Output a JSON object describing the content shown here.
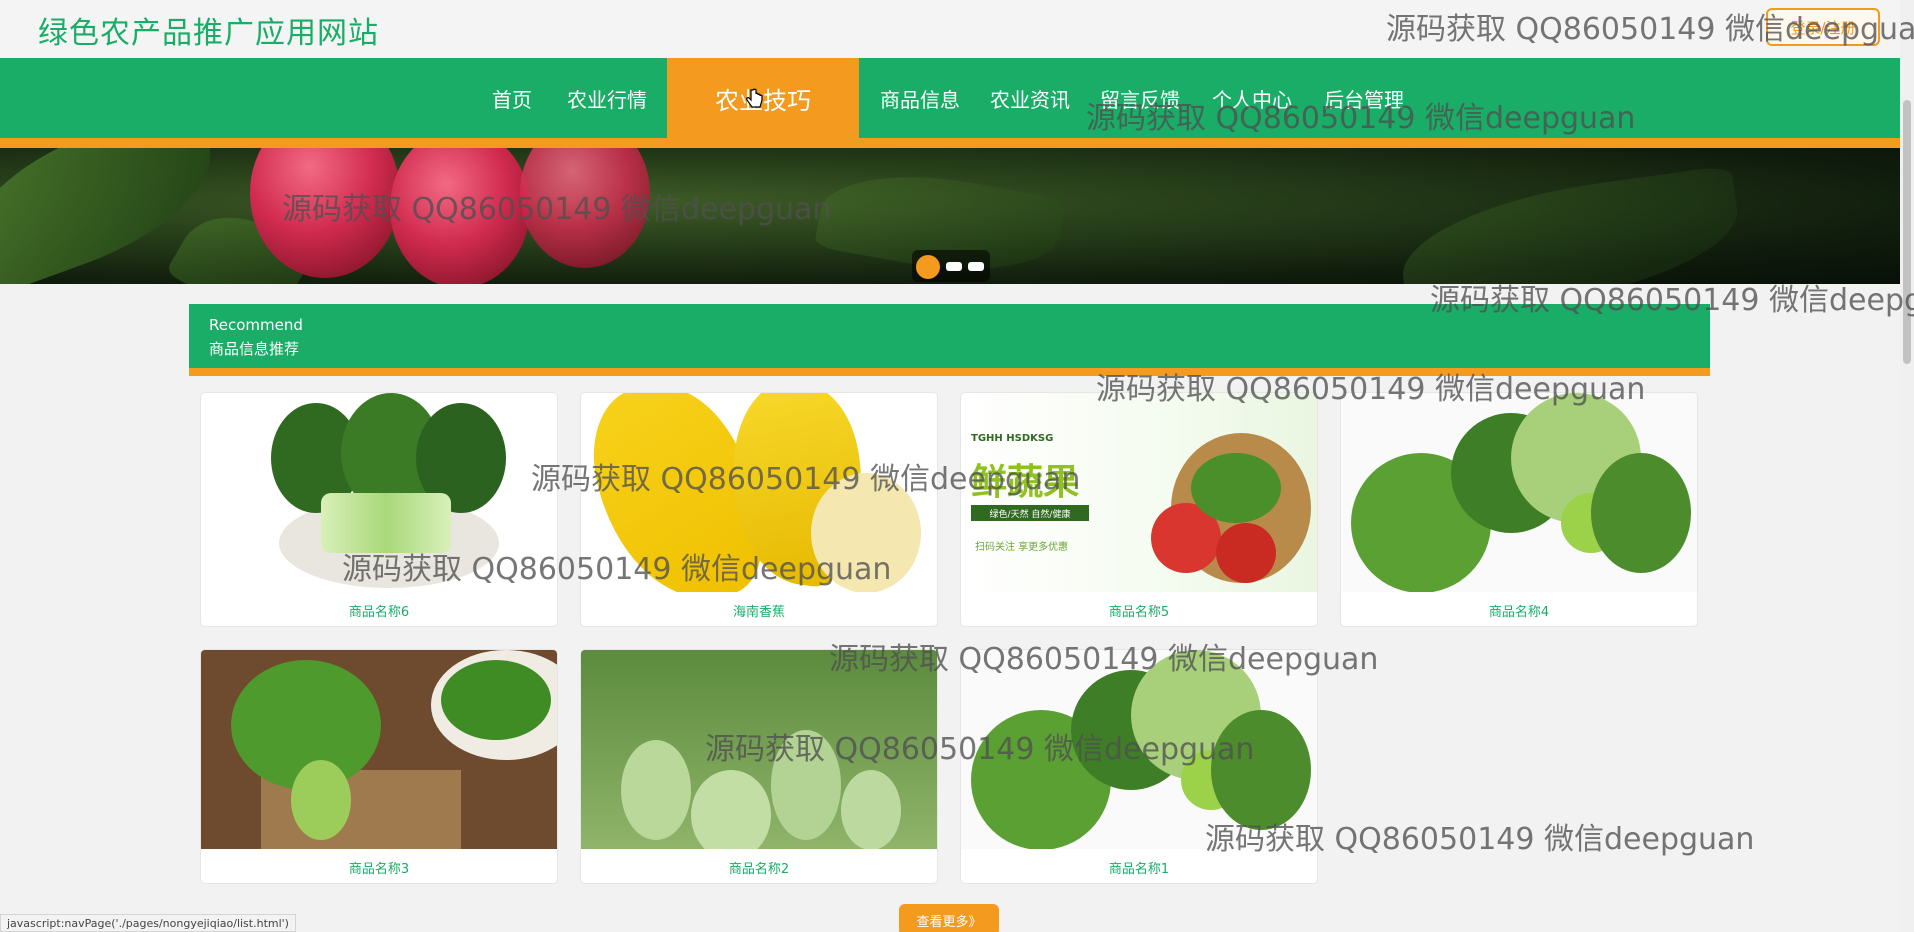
{
  "site": {
    "title": "绿色农产品推广应用网站",
    "login_label": "登录/注册"
  },
  "nav": {
    "items": [
      {
        "label": "首页"
      },
      {
        "label": "农业行情"
      },
      {
        "label": "农业技巧"
      },
      {
        "label": "商品信息"
      },
      {
        "label": "农业资讯"
      },
      {
        "label": "留言反馈"
      },
      {
        "label": "个人中心"
      },
      {
        "label": "后台管理"
      }
    ],
    "active": "农业技巧"
  },
  "recommend": {
    "title_en": "Recommend",
    "title_cn": "商品信息推荐"
  },
  "products": [
    {
      "name": "商品名称6"
    },
    {
      "name": "海南香蕉"
    },
    {
      "name": "商品名称5"
    },
    {
      "name": "商品名称4"
    },
    {
      "name": "商品名称3"
    },
    {
      "name": "商品名称2"
    },
    {
      "name": "商品名称1"
    }
  ],
  "promo_text": {
    "brand": "TGHH HSDKSG",
    "headline": "鲜蔬果",
    "tags": "绿色/天然  自然/健康",
    "slogan": "扫码关注 享更多优惠"
  },
  "more_label": "查看更多》",
  "status_bar": {
    "url": "javascript:navPage('./pages/nongyejiqiao/list.html')"
  },
  "watermark": "源码获取 QQ86050149 微信deepguan",
  "colors": {
    "primary": "#1aad67",
    "accent": "#f39a1f"
  },
  "icons": {
    "cursor": "hand-pointer-icon"
  }
}
